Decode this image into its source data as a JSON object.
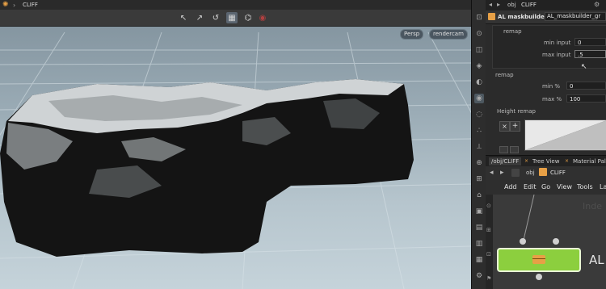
{
  "window": {
    "left_title": "CLIFF",
    "right_path": {
      "obj": "obj",
      "node": "CLIFF"
    }
  },
  "viewport": {
    "camera_persp": "Persp",
    "camera_render": "rendercam",
    "toolbar_icons": [
      "select-icon",
      "move-icon",
      "rotate-icon",
      "grid-icon",
      "record-icon"
    ]
  },
  "parameters": {
    "node_type": "AL maskbuilder",
    "node_name": "AL_maskbuilder_gr",
    "section_top": "remap",
    "min_input_label": "min input",
    "min_input_value": "0",
    "max_input_label": "max input",
    "max_input_value": ".5",
    "section_remap": "remap",
    "min_pct_label": "min %",
    "min_pct_value": "0",
    "max_pct_label": "max %",
    "max_pct_value": "100",
    "height_remap_label": "Height remap"
  },
  "network": {
    "tabs": [
      "/obj/CLIFF",
      "Tree View",
      "Material Palette"
    ],
    "path_obj": "obj",
    "path_node": "CLIFF",
    "menu": [
      "Add",
      "Edit",
      "Go",
      "View",
      "Tools",
      "La"
    ],
    "watermark": "Inde",
    "node_label": "AL",
    "node_color": "#8ccf3e"
  }
}
